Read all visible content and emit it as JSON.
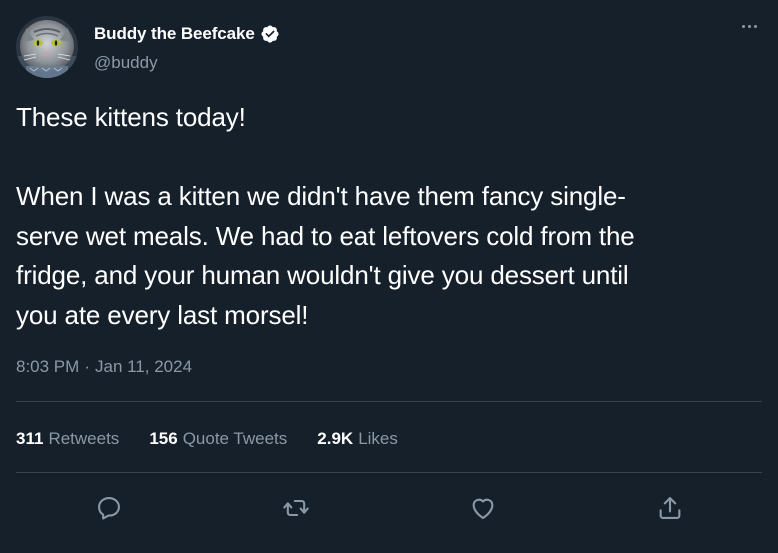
{
  "tweet": {
    "display_name": "Buddy the Beefcake",
    "handle": "@buddy",
    "verified": true,
    "body": "These kittens today!\n\nWhen I was a kitten we didn't have them fancy single-\nserve wet meals. We had to eat leftovers cold from the\nfridge, and your human wouldn't give you dessert until\nyou ate every last morsel!",
    "time": "8:03 PM",
    "separator": "·",
    "date": "Jan 11, 2024"
  },
  "stats": {
    "retweets": {
      "count": "311",
      "label": "Retweets"
    },
    "quotes": {
      "count": "156",
      "label": "Quote Tweets"
    },
    "likes": {
      "count": "2.9K",
      "label": "Likes"
    }
  },
  "icons": {
    "verified": "verified-badge-icon",
    "more": "more-options-icon",
    "reply": "reply-icon",
    "retweet": "retweet-icon",
    "like": "heart-icon",
    "share": "share-icon"
  },
  "colors": {
    "background": "#15202b",
    "text_primary": "#ffffff",
    "text_secondary": "#8b98a5",
    "divider": "#38444d"
  }
}
